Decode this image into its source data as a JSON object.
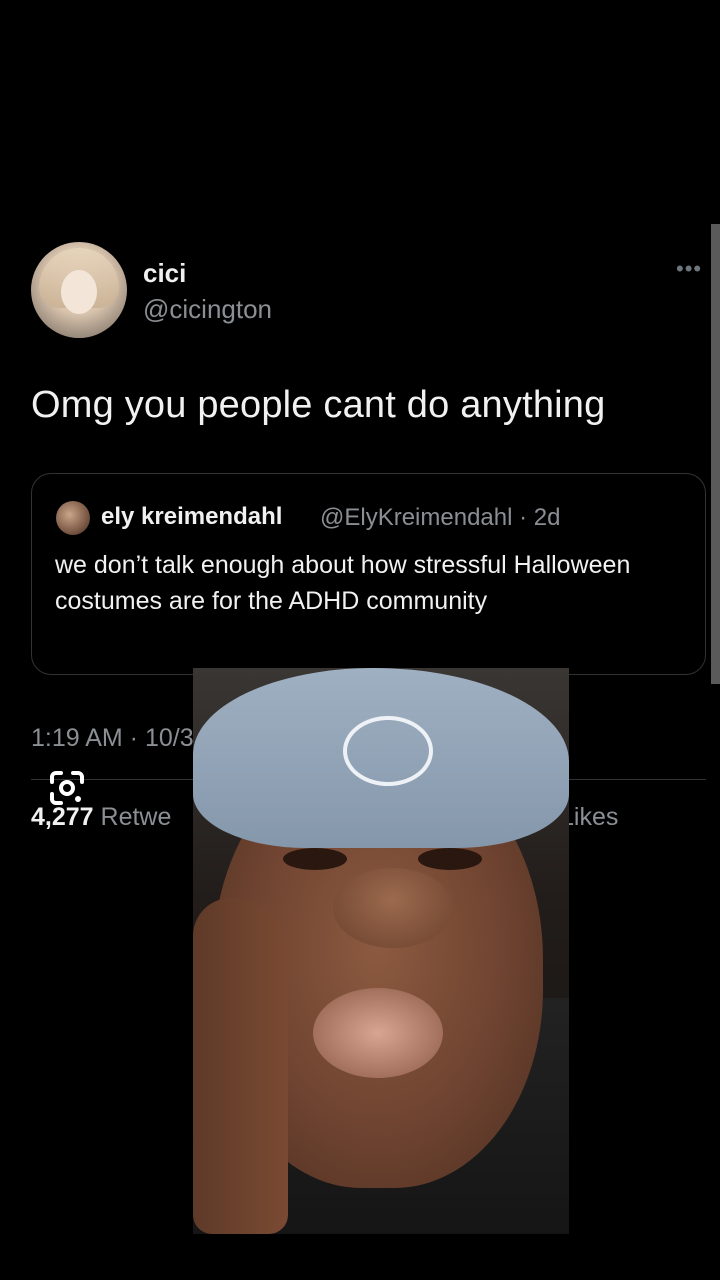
{
  "tweet": {
    "author_name": "cici",
    "author_handle": "@cicington",
    "more_icon": "•••",
    "text": "Omg you people cant do anything",
    "quoted": {
      "author_name": "ely kreimendahl",
      "meta": "@ElyKreimendahl · 2d",
      "text": "we don’t talk enough about how stressful Halloween costumes are for the ADHD community"
    },
    "timestamp": "1:19 AM · 10/30/",
    "retweets_count": "4,277",
    "retweets_label": "Retwe",
    "likes_label": "Likes"
  },
  "colors": {
    "background": "#000000",
    "primary_text": "#f1f1f1",
    "secondary_text": "#8b8f93",
    "border": "#2f3336"
  },
  "icons": {
    "lens": "google-lens-icon",
    "more": "more-horizontal-icon"
  }
}
